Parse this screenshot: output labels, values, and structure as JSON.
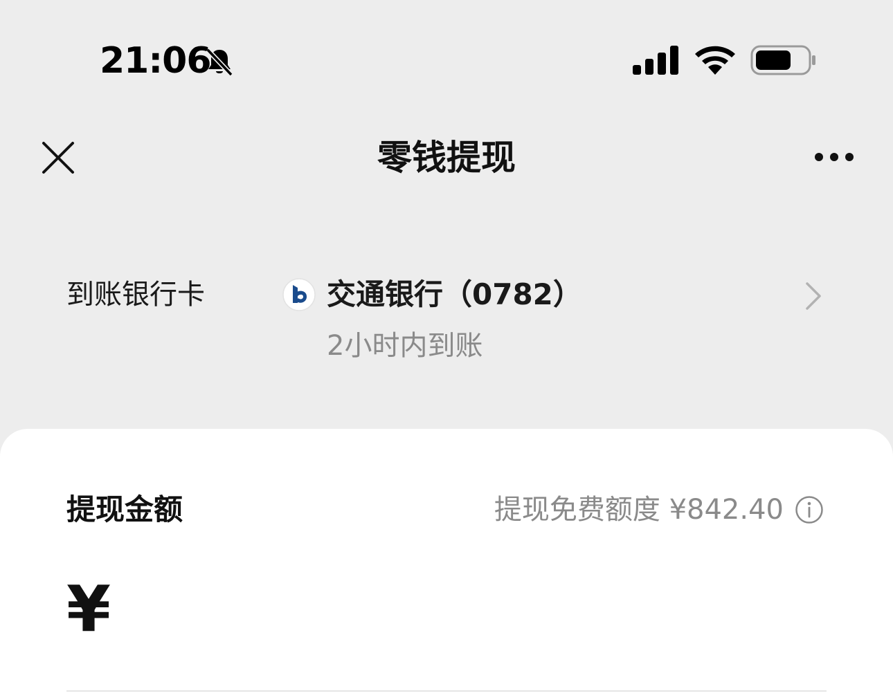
{
  "status_bar": {
    "time": "21:06",
    "icons": [
      "bell-muted-icon",
      "signal-icon",
      "wifi-icon",
      "battery-icon"
    ]
  },
  "nav": {
    "title": "零钱提现",
    "left_icon": "close-icon",
    "right_icon": "more-icon"
  },
  "bank": {
    "label": "到账银行卡",
    "name": "交通银行（0782）",
    "eta": "2小时内到账",
    "logo_color": "#1a4b8c"
  },
  "withdraw": {
    "label": "提现金额",
    "free_quota": "提现免费额度 ¥842.40",
    "currency": "¥",
    "amount_value": "",
    "amount_placeholder": ""
  },
  "colors": {
    "page_bg": "#ededed",
    "card_bg": "#ffffff",
    "secondary_text": "#8a8a8a"
  }
}
